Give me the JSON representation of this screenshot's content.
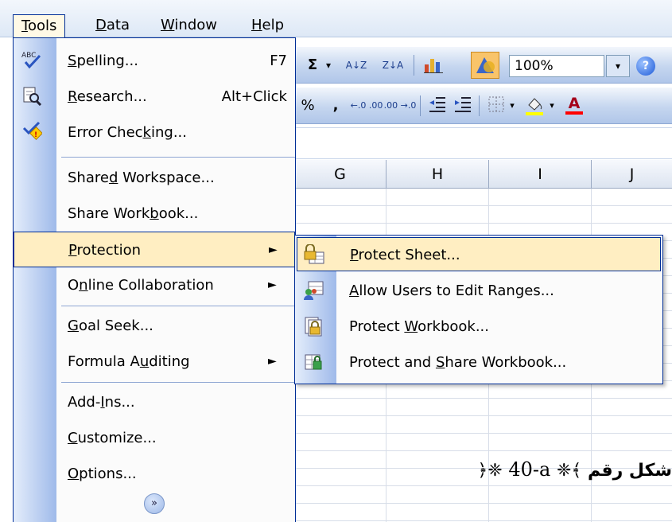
{
  "menubar": {
    "items": [
      {
        "label": "Tools",
        "mnemonic": "T"
      },
      {
        "label": "Data",
        "mnemonic": "D"
      },
      {
        "label": "Window",
        "mnemonic": "W"
      },
      {
        "label": "Help",
        "mnemonic": "H"
      }
    ]
  },
  "toolbar1": {
    "sigma": "Σ",
    "sigma_arrow": "▾",
    "sort_asc": "A↓Z",
    "sort_desc": "Z↓A",
    "zoom_value": "100%",
    "zoom_arrow": "▾",
    "help_icon": "?"
  },
  "toolbar2": {
    "percent": "%",
    "comma": ",",
    "inc_decimal": "←.0 .00",
    "dec_decimal": ".00 →.0",
    "font_color_letter": "A"
  },
  "columns": [
    "G",
    "H",
    "I",
    "J"
  ],
  "tools_menu": {
    "items": [
      {
        "before": "",
        "key": "S",
        "after": "pelling...",
        "shortcut": "F7",
        "icon": "spelling-icon"
      },
      {
        "before": "",
        "key": "R",
        "after": "esearch...",
        "shortcut": "Alt+Click",
        "icon": "research-icon"
      },
      {
        "before": "Error Chec",
        "key": "k",
        "after": "ing...",
        "shortcut": "",
        "icon": "error-checking-icon"
      },
      {
        "before": "Share",
        "key": "d",
        "after": " Workspace...",
        "shortcut": "",
        "icon": ""
      },
      {
        "before": "Share Work",
        "key": "b",
        "after": "ook...",
        "shortcut": "",
        "icon": ""
      },
      {
        "before": "",
        "key": "P",
        "after": "rotection",
        "shortcut": "",
        "icon": ""
      },
      {
        "before": "O",
        "key": "n",
        "after": "line Collaboration",
        "shortcut": "",
        "icon": ""
      },
      {
        "before": "",
        "key": "G",
        "after": "oal Seek...",
        "shortcut": "",
        "icon": ""
      },
      {
        "before": "Formula A",
        "key": "u",
        "after": "diting",
        "shortcut": "",
        "icon": ""
      },
      {
        "before": "Add-",
        "key": "I",
        "after": "ns...",
        "shortcut": "",
        "icon": ""
      },
      {
        "before": "",
        "key": "C",
        "after": "ustomize...",
        "shortcut": "",
        "icon": ""
      },
      {
        "before": "",
        "key": "O",
        "after": "ptions...",
        "shortcut": "",
        "icon": ""
      }
    ],
    "submenu_arrow": "►",
    "expand_chevron": "»"
  },
  "protection_submenu": {
    "items": [
      {
        "before": "",
        "key": "P",
        "after": "rotect Sheet...",
        "icon": "protect-sheet-icon"
      },
      {
        "before": "",
        "key": "A",
        "after": "llow Users to Edit Ranges...",
        "icon": "allow-users-icon"
      },
      {
        "before": "Protect ",
        "key": "W",
        "after": "orkbook...",
        "icon": "protect-workbook-icon"
      },
      {
        "before": "Protect and ",
        "key": "S",
        "after": "hare Workbook...",
        "icon": "protect-share-icon"
      }
    ]
  },
  "caption": {
    "arabic": "شكل رقم",
    "number": "40-a",
    "ornament_left": "﴾",
    "ornament_right": "﴿",
    "flower": "❈"
  },
  "colors": {
    "menu_border": "#002d96",
    "highlight": "#ffeec2",
    "gutter": "#9fbaea"
  }
}
